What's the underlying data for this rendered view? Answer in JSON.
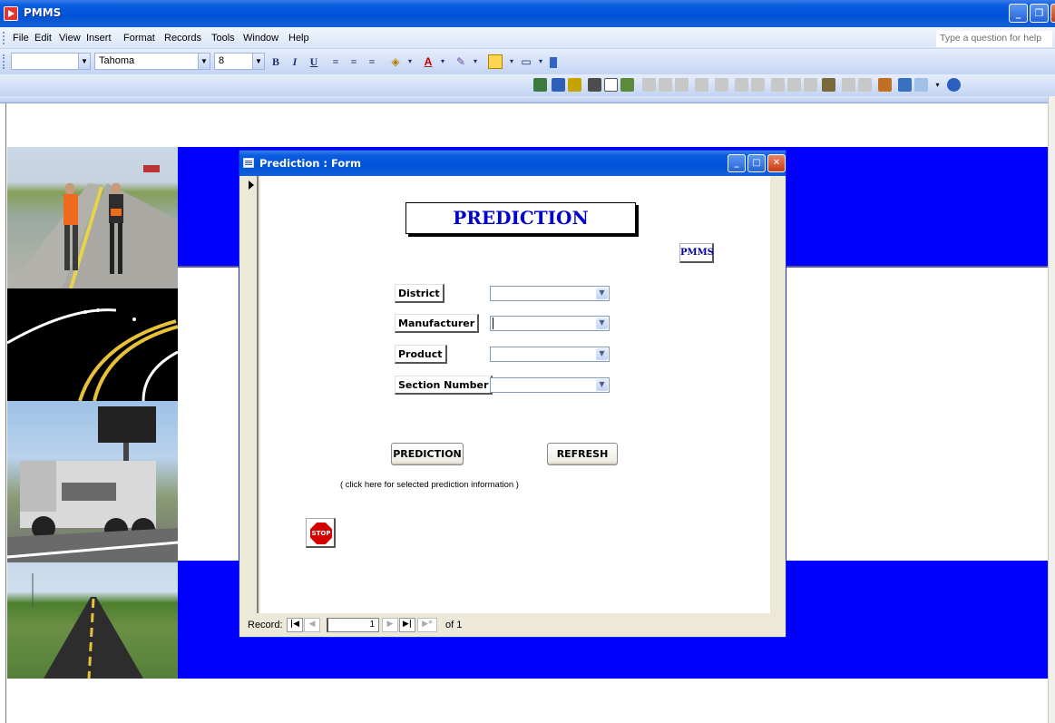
{
  "app": {
    "title": "PMMS"
  },
  "menu": {
    "items": [
      "File",
      "Edit",
      "View",
      "Insert",
      "Format",
      "Records",
      "Tools",
      "Window",
      "Help"
    ],
    "help_placeholder": "Type a question for help"
  },
  "format_toolbar": {
    "object_value": "",
    "font_name": "Tahoma",
    "font_size": "8",
    "bold": "B",
    "italic": "I",
    "underline": "U"
  },
  "form": {
    "window_title": "Prediction : Form",
    "heading": "PREDICTION",
    "pmms_button": "PMMS",
    "fields": [
      {
        "label": "District",
        "value": ""
      },
      {
        "label": "Manufacturer",
        "value": ""
      },
      {
        "label": "Product",
        "value": ""
      },
      {
        "label": "Section Number",
        "value": ""
      }
    ],
    "prediction_button": "PREDICTION",
    "refresh_button": "REFRESH",
    "hint_text": "( click here for selected prediction information )",
    "stop_label": "STOP"
  },
  "navigation": {
    "record_label": "Record:",
    "current_record": "1",
    "total_label": "of 1"
  }
}
